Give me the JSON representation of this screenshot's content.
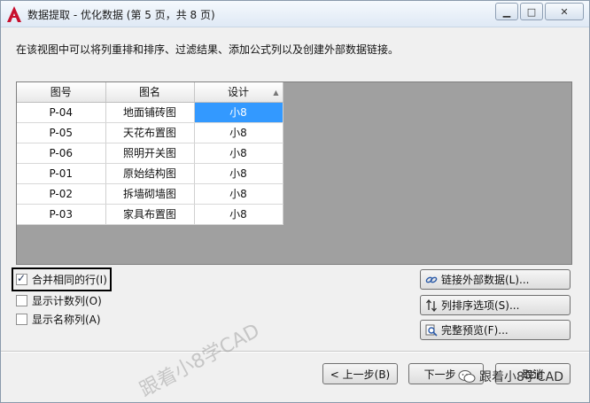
{
  "window": {
    "title": "数据提取 - 优化数据 (第 5 页，共 8 页)",
    "minimize_glyph": "▁",
    "maximize_glyph": "□",
    "close_glyph": "✕"
  },
  "description": "在该视图中可以将列重排和排序、过滤结果、添加公式列以及创建外部数据链接。",
  "grid": {
    "columns": [
      "图号",
      "图名",
      "设计"
    ],
    "rows": [
      [
        "P-04",
        "地面铺砖图",
        "小8"
      ],
      [
        "P-05",
        "天花布置图",
        "小8"
      ],
      [
        "P-06",
        "照明开关图",
        "小8"
      ],
      [
        "P-01",
        "原始结构图",
        "小8"
      ],
      [
        "P-02",
        "拆墙砌墙图",
        "小8"
      ],
      [
        "P-03",
        "家具布置图",
        "小8"
      ]
    ],
    "selected_cell": "小8",
    "sort_indicator": "▲"
  },
  "options": {
    "merge_rows": {
      "label": "合并相同的行(I)",
      "checked": true,
      "tick": "✓"
    },
    "show_count": {
      "label": "显示计数列(O)",
      "checked": false
    },
    "show_name": {
      "label": "显示名称列(A)",
      "checked": false
    }
  },
  "buttons": {
    "link_external": "链接外部数据(L)...",
    "sort_columns": "列排序选项(S)...",
    "full_preview": "完整预览(F)...",
    "back": "< 上一步(B)",
    "next": "下一步 >",
    "cancel": "取消"
  },
  "watermark": {
    "text1": "跟着小8学CAD",
    "badge": "跟着小8学CAD"
  },
  "colors": {
    "selection": "#3399ff",
    "grid_bg": "#a0a0a0",
    "app_icon": "#c8102e"
  }
}
